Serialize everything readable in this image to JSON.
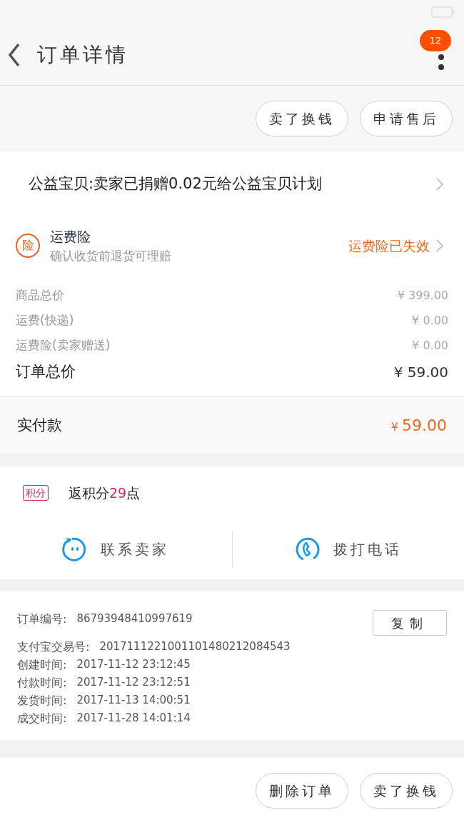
{
  "header": {
    "title": "订单详情",
    "badge": "12"
  },
  "top_actions": [
    "卖了换钱",
    "申请售后"
  ],
  "charity": {
    "text": "公益宝贝:卖家已捐赠0.02元给公益宝贝计划"
  },
  "insurance": {
    "icon_text": "险",
    "title": "运费险",
    "subtitle": "确认收货前退货可理赔",
    "status": "运费险已失效"
  },
  "prices": [
    {
      "kind": "minor",
      "label": "商品总价",
      "amount": "¥ 399.00"
    },
    {
      "kind": "minor",
      "label": "运费(快递)",
      "amount": "¥ 0.00"
    },
    {
      "kind": "minor",
      "label": "运费险(卖家赠送)",
      "amount": "¥ 0.00"
    },
    {
      "kind": "total",
      "label": "订单总价",
      "amount": "¥ 59.00"
    }
  ],
  "paid": {
    "label": "实付款",
    "currency": "¥",
    "amount": "59.00"
  },
  "points": {
    "tag": "积分",
    "prefix": "返积分",
    "value": "29",
    "suffix": "点"
  },
  "contacts": [
    {
      "kind": "chat",
      "label": "联系卖家"
    },
    {
      "kind": "phone",
      "label": "拨打电话"
    }
  ],
  "order_info": {
    "copy_button": "复制",
    "rows": [
      {
        "label": "订单编号:",
        "value": "86793948410997619"
      },
      {
        "label": "支付宝交易号:",
        "value": "2017111221001101480212084543"
      },
      {
        "label": "创建时间:",
        "value": "2017-11-12 23:12:45"
      },
      {
        "label": "付款时间:",
        "value": "2017-11-12 23:12:51"
      },
      {
        "label": "发货时间:",
        "value": "2017-11-13 14:00:51"
      },
      {
        "label": "成交时间:",
        "value": "2017-11-28 14:01:14"
      }
    ]
  },
  "bottom_actions": [
    "删除订单",
    "卖了换钱"
  ]
}
